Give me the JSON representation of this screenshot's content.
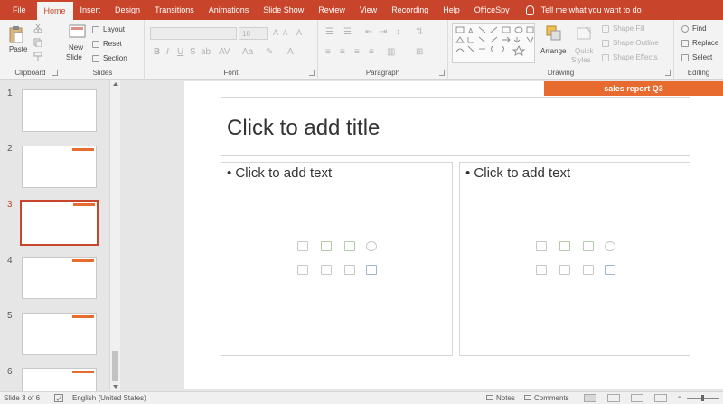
{
  "tabs": [
    "File",
    "Home",
    "Insert",
    "Design",
    "Transitions",
    "Animations",
    "Slide Show",
    "Review",
    "View",
    "Recording",
    "Help",
    "OfficeSpy"
  ],
  "active_tab": "Home",
  "tell_me": "Tell me what you want to do",
  "accent_color": "#c8452b",
  "ribbon": {
    "clipboard": {
      "paste": "Paste",
      "label": "Clipboard"
    },
    "slides": {
      "new_slide_line1": "New",
      "new_slide_line2": "Slide",
      "layout": "Layout",
      "reset": "Reset",
      "section": "Section",
      "label": "Slides"
    },
    "font": {
      "size": "18",
      "label": "Font"
    },
    "paragraph": {
      "label": "Paragraph"
    },
    "drawing": {
      "arrange": "Arrange",
      "quick_styles_line1": "Quick",
      "quick_styles_line2": "Styles",
      "shape_fill": "Shape Fill",
      "shape_outline": "Shape Outline",
      "shape_effects": "Shape Effects",
      "label": "Drawing"
    },
    "editing": {
      "find": "Find",
      "replace": "Replace",
      "select": "Select",
      "label": "Editing"
    }
  },
  "thumbnails": {
    "numbers": [
      "1",
      "2",
      "3",
      "4",
      "5",
      "6"
    ],
    "selected": "3"
  },
  "slide": {
    "banner": "sales report Q3",
    "banner_color": "#e76b2e",
    "title_placeholder": "Click to add title",
    "left_text": "Click to add text",
    "right_text": "Click to add text"
  },
  "status": {
    "slide_info": "Slide 3 of 6",
    "language": "English (United States)",
    "notes": "Notes",
    "comments": "Comments"
  }
}
